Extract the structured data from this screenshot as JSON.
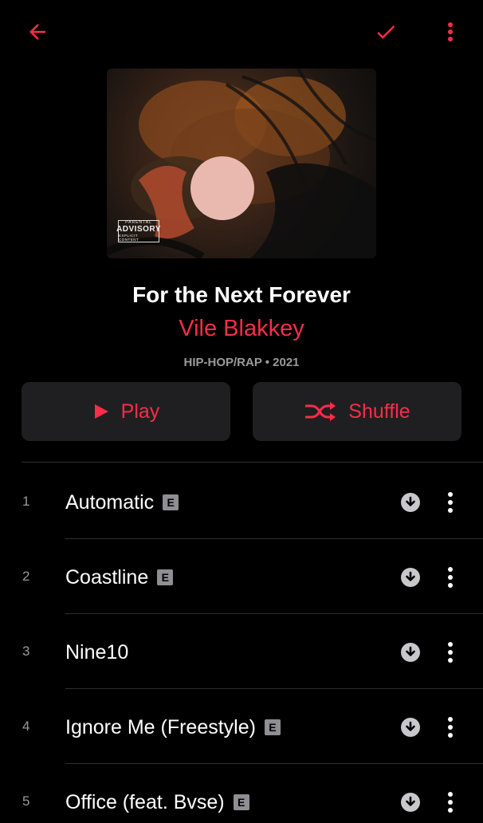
{
  "colors": {
    "accent": "#fa2d48",
    "background": "#000000",
    "button_bg": "#1f1f21",
    "secondary_text": "#9a9a9a"
  },
  "header": {
    "back_icon": "arrow-left-icon",
    "check_icon": "checkmark-icon",
    "more_icon": "vertical-ellipsis-icon"
  },
  "album": {
    "art_advisory": {
      "line1": "PARENTAL",
      "line2": "ADVISORY",
      "line3": "EXPLICIT CONTENT"
    },
    "title": "For the Next Forever",
    "artist": "Vile Blakkey",
    "meta": "HIP-HOP/RAP • 2021"
  },
  "actions": {
    "play_label": "Play",
    "play_icon": "play-icon",
    "shuffle_label": "Shuffle",
    "shuffle_icon": "shuffle-icon"
  },
  "tracks": [
    {
      "number": "1",
      "title": "Automatic",
      "explicit": "E"
    },
    {
      "number": "2",
      "title": "Coastline",
      "explicit": "E"
    },
    {
      "number": "3",
      "title": "Nine10",
      "explicit": ""
    },
    {
      "number": "4",
      "title": "Ignore Me (Freestyle)",
      "explicit": "E"
    },
    {
      "number": "5",
      "title": "Office (feat. Bvse)",
      "explicit": "E"
    }
  ]
}
